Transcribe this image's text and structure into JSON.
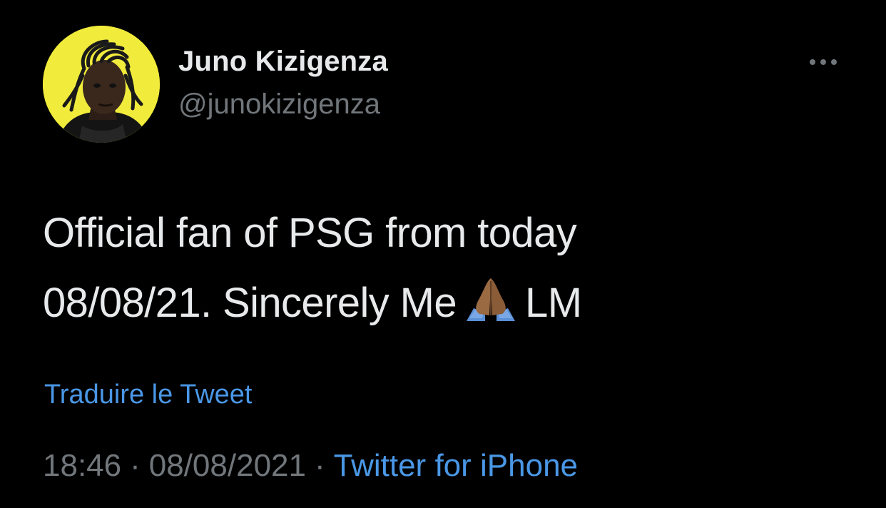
{
  "tweet": {
    "author": {
      "display_name": "Juno Kizigenza",
      "handle": "@junokizigenza",
      "avatar_bg": "#f1ec3b"
    },
    "more_icon": "ellipsis-icon",
    "text_line_1": "Official fan of PSG from today",
    "text_line_2_pre": "08/08/21. Sincerely Me",
    "text_line_2_emoji": "folded-hands-emoji",
    "text_line_2_post": "LM",
    "translate_label": "Traduire le Tweet",
    "time": "18:46",
    "separator": "·",
    "date": "08/08/2021",
    "source": "Twitter for iPhone",
    "link_color": "#4a97e6",
    "secondary_color": "#71767b"
  }
}
